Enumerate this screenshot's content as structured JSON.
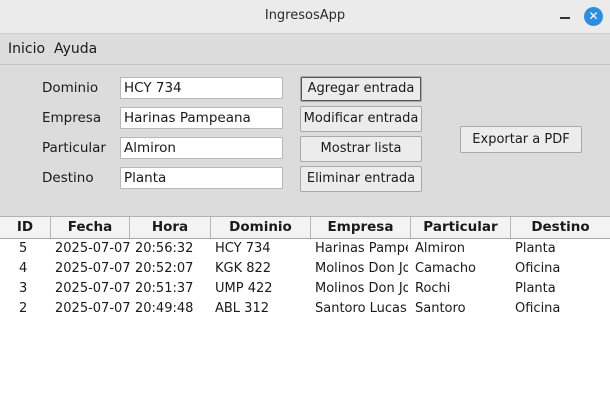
{
  "window": {
    "title": "IngresosApp",
    "close_glyph": "✕"
  },
  "menu": [
    "Inicio",
    "Ayuda"
  ],
  "form": {
    "fields": [
      {
        "label": "Dominio",
        "value": "HCY 734"
      },
      {
        "label": "Empresa",
        "value": "Harinas Pampeana"
      },
      {
        "label": "Particular",
        "value": "Almiron"
      },
      {
        "label": "Destino",
        "value": "Planta"
      }
    ],
    "buttons": {
      "add": "Agregar entrada",
      "modify": "Modificar entrada",
      "show": "Mostrar lista",
      "delete": "Eliminar entrada",
      "export": "Exportar a PDF"
    }
  },
  "table": {
    "columns": [
      "ID",
      "Fecha",
      "Hora",
      "Dominio",
      "Empresa",
      "Particular",
      "Destino"
    ],
    "rows": [
      [
        "5",
        "2025-07-07",
        "20:56:32",
        "HCY 734",
        "Harinas Pampe",
        "Almiron",
        "Planta"
      ],
      [
        "4",
        "2025-07-07",
        "20:52:07",
        "KGK 822",
        "Molinos Don Jo",
        "Camacho",
        "Oficina"
      ],
      [
        "3",
        "2025-07-07",
        "20:51:37",
        "UMP 422",
        "Molinos Don Jo",
        "Rochi",
        "Planta"
      ],
      [
        "2",
        "2025-07-07",
        "20:49:48",
        "ABL 312",
        "Santoro Lucas S",
        "Santoro",
        "Oficina"
      ]
    ]
  },
  "colors": {
    "close_button": "#2f8dde",
    "background": "#dcdcdc",
    "table_bg": "#ffffff"
  },
  "icons": {
    "minimize": "minimize-icon",
    "close": "close-icon"
  }
}
